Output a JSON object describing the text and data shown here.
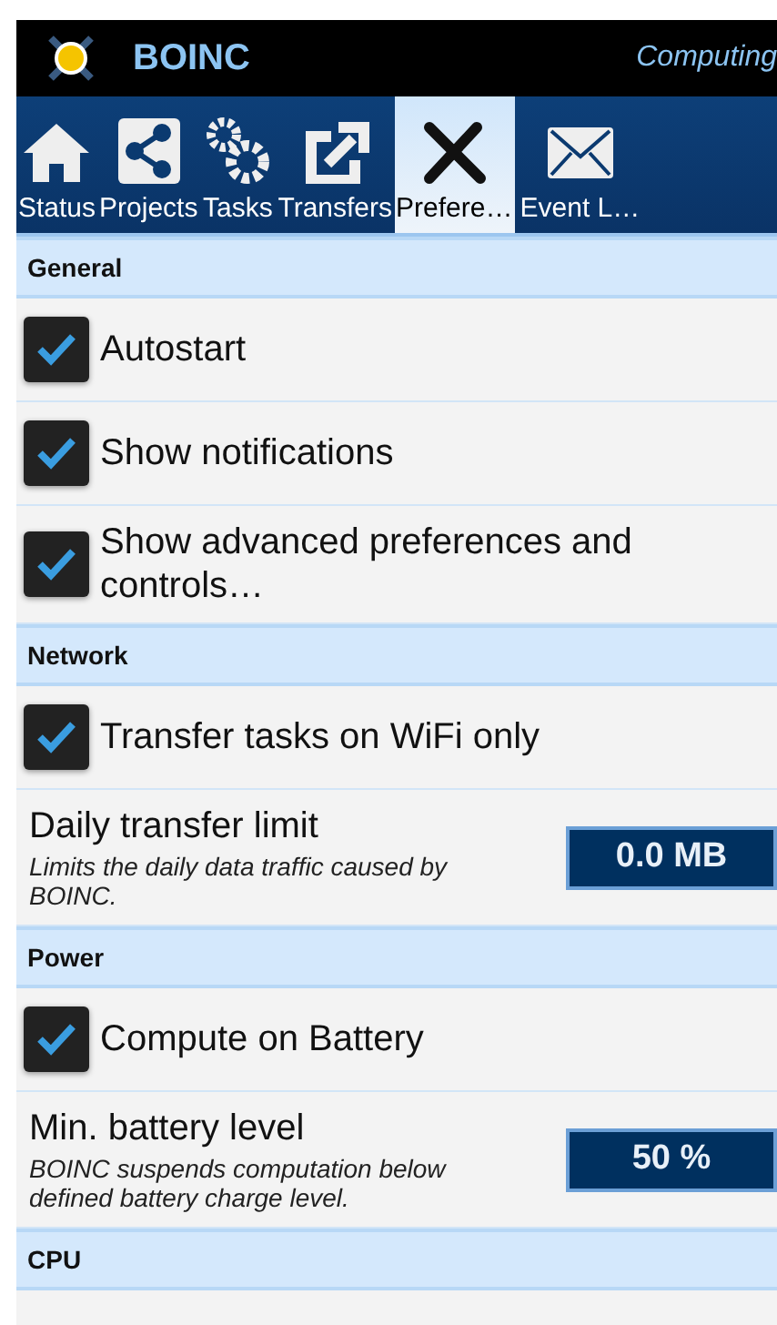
{
  "app_bar": {
    "title": "BOINC",
    "status": "Computing"
  },
  "tabs": [
    {
      "label": "Status",
      "selected": false
    },
    {
      "label": "Projects",
      "selected": false
    },
    {
      "label": "Tasks",
      "selected": false
    },
    {
      "label": "Transfers",
      "selected": false
    },
    {
      "label": "Prefere…",
      "selected": true
    },
    {
      "label": "Event L…",
      "selected": false
    }
  ],
  "sections": [
    {
      "title": "General",
      "items": [
        {
          "kind": "checkbox",
          "label": "Autostart",
          "checked": true
        },
        {
          "kind": "checkbox",
          "label": "Show notifications",
          "checked": true
        },
        {
          "kind": "checkbox",
          "label": "Show advanced preferences and controls…",
          "checked": true
        }
      ]
    },
    {
      "title": "Network",
      "items": [
        {
          "kind": "checkbox",
          "label": "Transfer tasks on WiFi only",
          "checked": true
        },
        {
          "kind": "value",
          "label": "Daily transfer limit",
          "description": "Limits the daily data traffic caused by BOINC.",
          "value": "0.0 MB"
        }
      ]
    },
    {
      "title": "Power",
      "items": [
        {
          "kind": "checkbox",
          "label": "Compute on Battery",
          "checked": true
        },
        {
          "kind": "value",
          "label": "Min. battery level",
          "description": "BOINC suspends computation below defined battery charge level.",
          "value": "50 %"
        }
      ]
    },
    {
      "title": "CPU"
    }
  ]
}
